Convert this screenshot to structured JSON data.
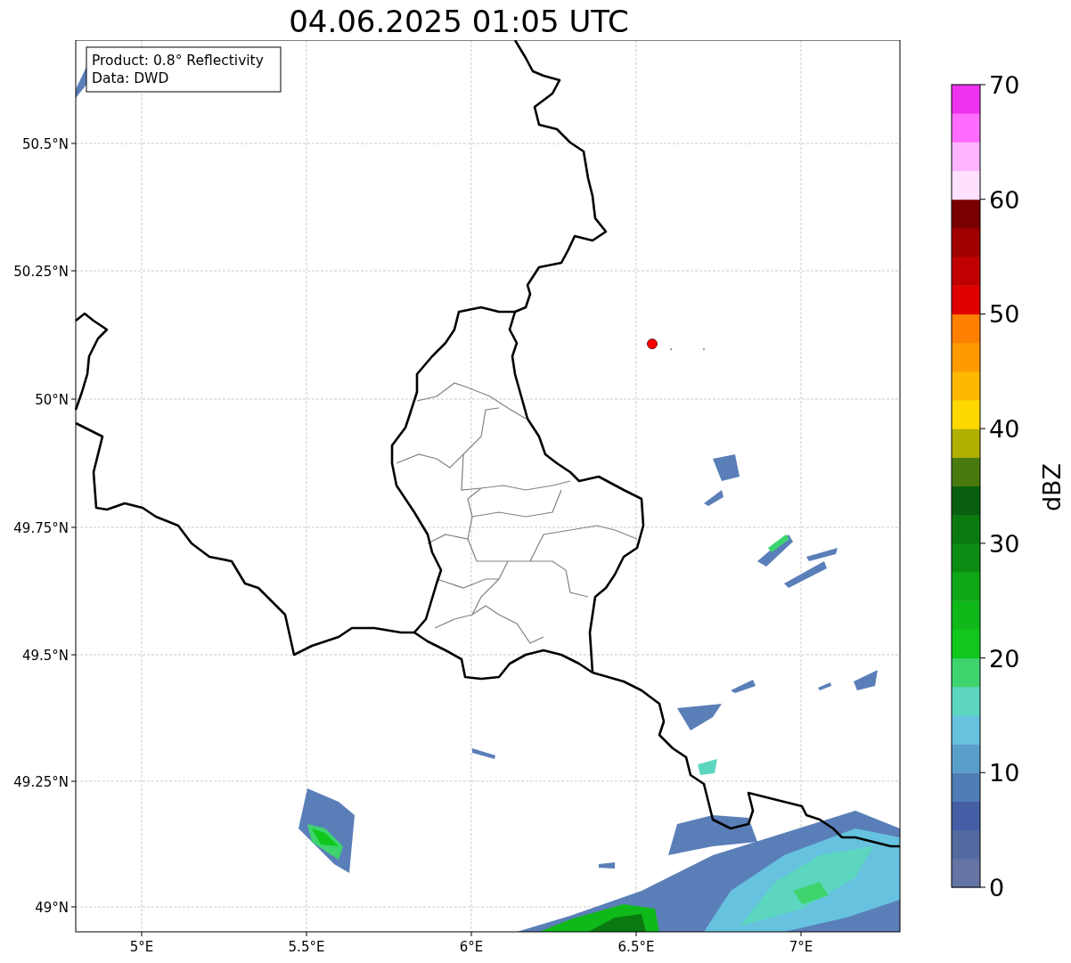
{
  "title": "04.06.2025 01:05 UTC",
  "info_box": [
    "Product: 0.8° Reflectivity",
    "Data: DWD"
  ],
  "x_ticks": [
    "5°E",
    "5.5°E",
    "6°E",
    "6.5°E",
    "7°E"
  ],
  "y_ticks": [
    "50.5°N",
    "50.25°N",
    "50°N",
    "49.75°N",
    "49.5°N",
    "49.25°N",
    "49°N"
  ],
  "colorbar": {
    "label": "dBZ",
    "ticks": [
      "70",
      "60",
      "50",
      "40",
      "30",
      "20",
      "10",
      "0"
    ],
    "bins": [
      {
        "color": "#6474a4"
      },
      {
        "color": "#53699f"
      },
      {
        "color": "#445fa6"
      },
      {
        "color": "#4f7db5"
      },
      {
        "color": "#5a9fca"
      },
      {
        "color": "#66c2de"
      },
      {
        "color": "#5dd6c0"
      },
      {
        "color": "#3dd46e"
      },
      {
        "color": "#11c71c"
      },
      {
        "color": "#10b91a"
      },
      {
        "color": "#0ea816"
      },
      {
        "color": "#0c8c12"
      },
      {
        "color": "#0a7a10"
      },
      {
        "color": "#086010"
      },
      {
        "color": "#4a7a0e"
      },
      {
        "color": "#b0b000"
      },
      {
        "color": "#ffd800"
      },
      {
        "color": "#ffb800"
      },
      {
        "color": "#ff9a00"
      },
      {
        "color": "#ff7f00"
      },
      {
        "color": "#e00000"
      },
      {
        "color": "#c00000"
      },
      {
        "color": "#a00000"
      },
      {
        "color": "#780000"
      },
      {
        "color": "#ffe0ff"
      },
      {
        "color": "#ffb4ff"
      },
      {
        "color": "#ff6cff"
      },
      {
        "color": "#ee33ee"
      }
    ]
  }
}
